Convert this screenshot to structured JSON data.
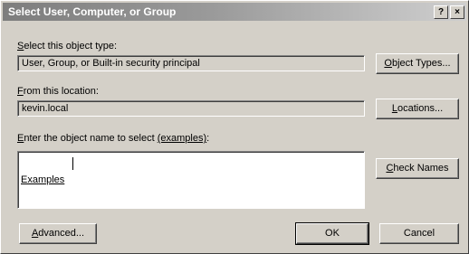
{
  "window": {
    "title": "Select User, Computer, or Group",
    "help_btn": "?",
    "close_btn": "×"
  },
  "object_type": {
    "label_key": "S",
    "label_rest": "elect this object type:",
    "value": "User, Group, or Built-in security principal",
    "button_key": "O",
    "button_rest": "bject Types..."
  },
  "location": {
    "label_key": "F",
    "label_rest": "rom this location:",
    "value": "kevin.local",
    "button_key": "L",
    "button_rest": "ocations..."
  },
  "object_names": {
    "label_key": "E",
    "label_rest": "nter the object name to select ",
    "examples_link": "(examples)",
    "label_colon": ":",
    "value": "",
    "sample_text": "Examples",
    "check_key": "C",
    "check_rest": "heck Names"
  },
  "footer": {
    "advanced_key": "A",
    "advanced_rest": "dvanced...",
    "ok": "OK",
    "cancel": "Cancel"
  }
}
